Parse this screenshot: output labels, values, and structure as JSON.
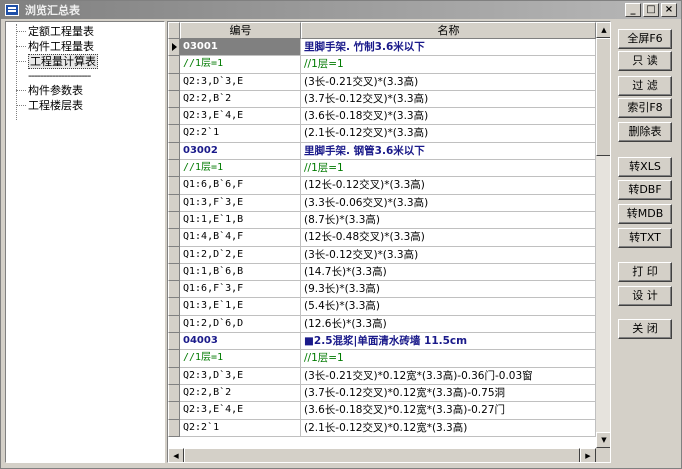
{
  "window": {
    "title": "浏览汇总表"
  },
  "window_buttons": {
    "minimize": "_",
    "maximize": "□",
    "close": "×"
  },
  "tree": {
    "items": [
      "定额工程量表",
      "构件工程量表",
      "工程量计算表"
    ],
    "separator": "---------------------",
    "items2": [
      "构件参数表",
      "工程楼层表"
    ]
  },
  "grid": {
    "columns": [
      "编号",
      "名称"
    ],
    "rows": [
      {
        "code": "03001",
        "name": "里脚手架. 竹制3.6米以下",
        "kind": "head"
      },
      {
        "code": "//1层=1",
        "name": "//1层=1",
        "kind": "floor"
      },
      {
        "code": "Q2:3,D`3,E",
        "name": "(3长-0.21交叉)*(3.3高)",
        "kind": "normal"
      },
      {
        "code": "Q2:2,B`2",
        "name": "(3.7长-0.12交叉)*(3.3高)",
        "kind": "normal"
      },
      {
        "code": "Q2:3,E`4,E",
        "name": "(3.6长-0.18交叉)*(3.3高)",
        "kind": "normal"
      },
      {
        "code": "Q2:2`1",
        "name": "(2.1长-0.12交叉)*(3.3高)",
        "kind": "normal"
      },
      {
        "code": "03002",
        "name": "里脚手架. 钢管3.6米以下",
        "kind": "head"
      },
      {
        "code": "//1层=1",
        "name": "//1层=1",
        "kind": "floor"
      },
      {
        "code": "Q1:6,B`6,F",
        "name": "(12长-0.12交叉)*(3.3高)",
        "kind": "normal"
      },
      {
        "code": "Q1:3,F`3,E",
        "name": "(3.3长-0.06交叉)*(3.3高)",
        "kind": "normal"
      },
      {
        "code": "Q1:1,E`1,B",
        "name": "(8.7长)*(3.3高)",
        "kind": "normal"
      },
      {
        "code": "Q1:4,B`4,F",
        "name": "(12长-0.48交叉)*(3.3高)",
        "kind": "normal"
      },
      {
        "code": "Q1:2,D`2,E",
        "name": "(3长-0.12交叉)*(3.3高)",
        "kind": "normal"
      },
      {
        "code": "Q1:1,B`6,B",
        "name": "(14.7长)*(3.3高)",
        "kind": "normal"
      },
      {
        "code": "Q1:6,F`3,F",
        "name": "(9.3长)*(3.3高)",
        "kind": "normal"
      },
      {
        "code": "Q1:3,E`1,E",
        "name": "(5.4长)*(3.3高)",
        "kind": "normal"
      },
      {
        "code": "Q1:2,D`6,D",
        "name": "(12.6长)*(3.3高)",
        "kind": "normal"
      },
      {
        "code": "04003",
        "name": "■2.5混浆|单面清水砖墙 11.5cm",
        "kind": "head"
      },
      {
        "code": "//1层=1",
        "name": "//1层=1",
        "kind": "floor"
      },
      {
        "code": "Q2:3,D`3,E",
        "name": "(3长-0.21交叉)*0.12宽*(3.3高)-0.36门-0.03窗",
        "kind": "normal"
      },
      {
        "code": "Q2:2,B`2",
        "name": "(3.7长-0.12交叉)*0.12宽*(3.3高)-0.75洞",
        "kind": "normal"
      },
      {
        "code": "Q2:3,E`4,E",
        "name": "(3.6长-0.18交叉)*0.12宽*(3.3高)-0.27门",
        "kind": "normal"
      },
      {
        "code": "Q2:2`1",
        "name": "(2.1长-0.12交叉)*0.12宽*(3.3高)",
        "kind": "normal"
      }
    ]
  },
  "buttons": [
    {
      "name": "fullscreen-button",
      "label": "全屏F6"
    },
    {
      "name": "readonly-button",
      "label": "只 读"
    },
    {
      "name": "filter-button",
      "label": "过 滤"
    },
    {
      "name": "index-button",
      "label": "索引F8"
    },
    {
      "name": "delete-table-button",
      "label": "删除表"
    },
    {
      "name": "export-xls-button",
      "label": "转XLS"
    },
    {
      "name": "export-dbf-button",
      "label": "转DBF"
    },
    {
      "name": "export-mdb-button",
      "label": "转MDB"
    },
    {
      "name": "export-txt-button",
      "label": "转TXT"
    },
    {
      "name": "print-button",
      "label": "打 印"
    },
    {
      "name": "design-button",
      "label": "设 计"
    },
    {
      "name": "close-button",
      "label": "关 闭"
    }
  ]
}
